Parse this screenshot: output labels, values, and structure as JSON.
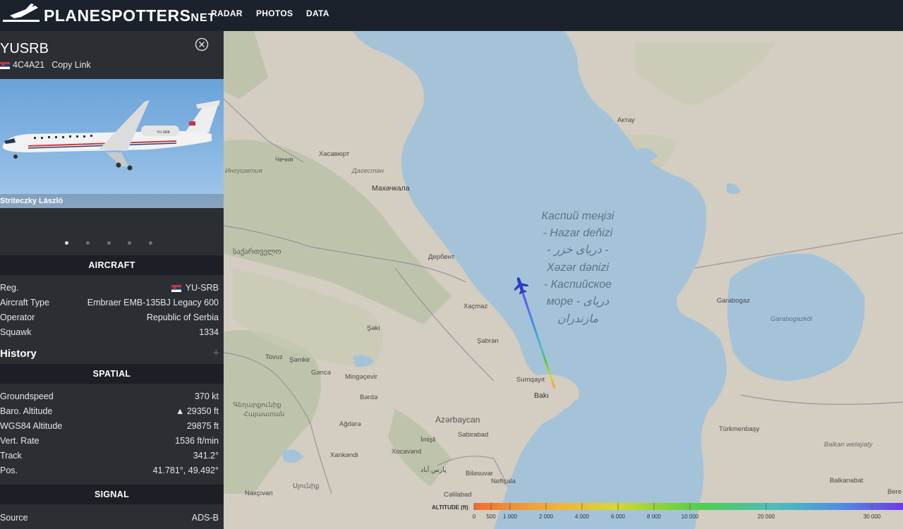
{
  "header": {
    "logo_main": "PLANESPOTTERS",
    "logo_suffix": "NET",
    "nav": [
      "RADAR",
      "PHOTOS",
      "DATA"
    ]
  },
  "aircraft_panel": {
    "registration_title": "YUSRB",
    "hex": "4C4A21",
    "copy_link": "Copy Link",
    "photo_credit": "Striteczky László",
    "photo_count": 5,
    "active_photo_index": 0,
    "aircraft_section": "AIRCRAFT",
    "aircraft_rows": [
      {
        "key": "Reg.",
        "value": "YU-SRB"
      },
      {
        "key": "Aircraft Type",
        "value": "Embraer EMB-135BJ Legacy 600"
      },
      {
        "key": "Operator",
        "value": "Republic of Serbia"
      },
      {
        "key": "Squawk",
        "value": "1334"
      }
    ],
    "history_label": "History",
    "history_plus": "+",
    "spatial_section": "SPATIAL",
    "spatial_rows": [
      {
        "key": "Groundspeed",
        "value": "370 kt"
      },
      {
        "key": "Baro. Altitude",
        "value": "▲ 29350 ft"
      },
      {
        "key": "WGS84 Altitude",
        "value": "29875 ft"
      },
      {
        "key": "Vert. Rate",
        "value": "1536 ft/min"
      },
      {
        "key": "Track",
        "value": "341.2°"
      },
      {
        "key": "Pos.",
        "value": "41.781°, 49.492°"
      }
    ],
    "signal_section": "SIGNAL",
    "signal_rows": [
      {
        "key": "Source",
        "value": "ADS-B"
      }
    ]
  },
  "map": {
    "sea_label_lines": [
      "Каспий теңізі",
      "- Hazar deňizi",
      "- دریای خزر -",
      "Xəzər dənizi",
      "- Каспийское",
      "море - دریای",
      "مازندران"
    ],
    "places": {
      "aktau": "Актау",
      "khasavyurt": "Хасавюрт",
      "chechnya": "Чечня",
      "dagestan": "Дагестан",
      "ingushetia": "Ингушетия",
      "makhachkala": "Махачкала",
      "derbent": "Дербент",
      "georgia": "საქართველო",
      "xacmaz": "Xaçmaz",
      "saki": "Şəki",
      "sabran": "Şabran",
      "tovuz": "Tovuz",
      "samkir": "Şəmkir",
      "ganca": "Gəncə",
      "mingacevir": "Mingəçevir",
      "sumqayit": "Sumqayıt",
      "baki": "Bakı",
      "barda": "Bərdə",
      "armenia": "Գեղարքունիք",
      "armenia2": "Հայաստան",
      "agdara": "Ağdərə",
      "azerbaijan": "Azərbaycan",
      "sabirabad": "Sabirabad",
      "imisli": "İmişli",
      "xocavand": "Xocavənd",
      "xankandi": "Xankəndi",
      "iran_label": "پارس آباد",
      "bilasuvar": "Biləsuvar",
      "syunik": "Սյունիք",
      "naxcivan": "Naxçıvan",
      "calilabad": "Cəlilabad",
      "neftcala": "Neftçala",
      "garabogaz": "Garabogaz",
      "garabogazkol": "Garabogazköl",
      "turkmenbasy": "Türkmenbaşy",
      "balkan": "Balkan welaýaty",
      "balkanabat": "Balkanabat",
      "bereket": "Bere"
    },
    "legend": {
      "title": "ALTITUDE (ft)",
      "ticks": [
        "0",
        "500",
        "1 000",
        "2 000",
        "4 000",
        "6 000",
        "8 000",
        "10 000",
        "20 000",
        "30 000"
      ]
    },
    "colors": {
      "water": "#a5c3d8",
      "land": "#d3cdc2",
      "plane": "#2b3ed1"
    }
  }
}
